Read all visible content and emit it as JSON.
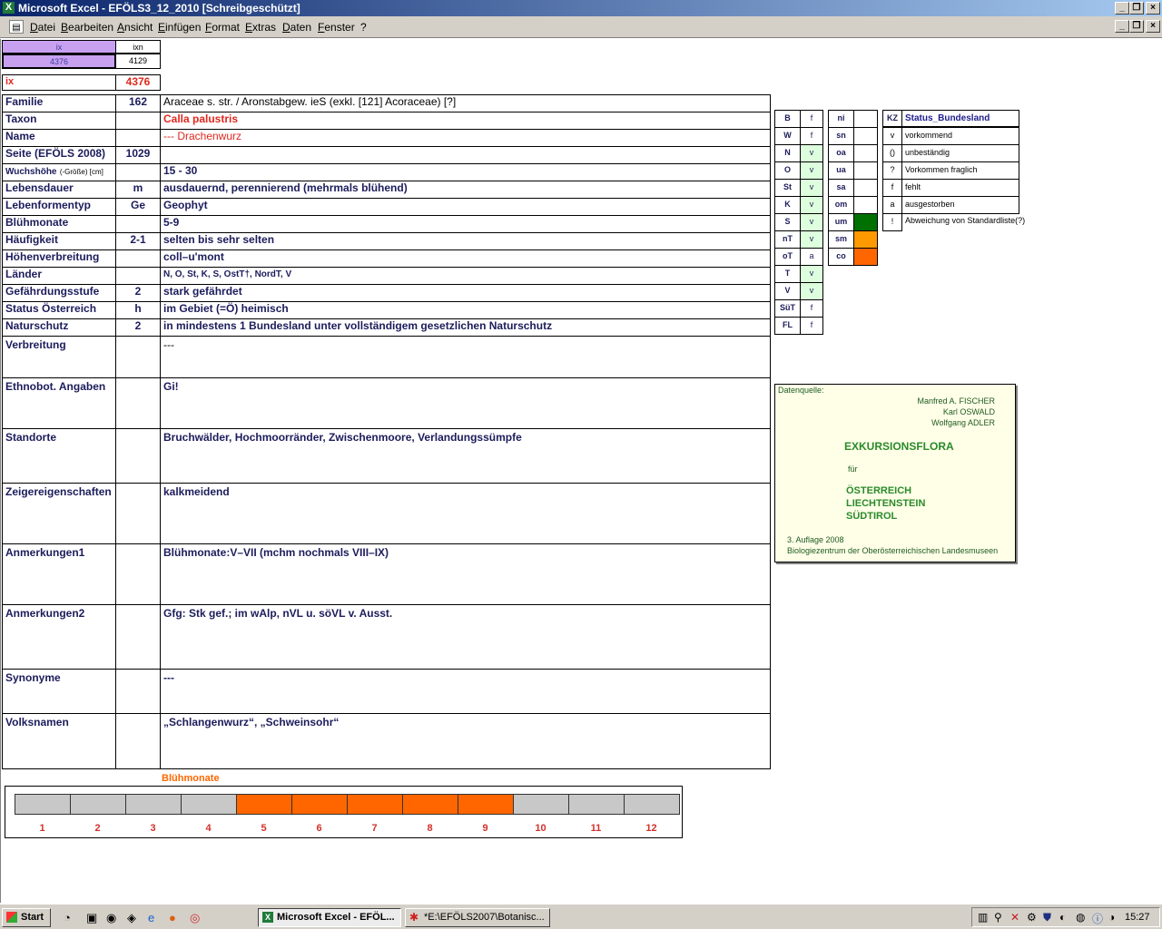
{
  "window": {
    "title": "Microsoft Excel - EFÖLS3_12_2010  [Schreibgeschützt]"
  },
  "menu": [
    "Datei",
    "Bearbeiten",
    "Ansicht",
    "Einfügen",
    "Format",
    "Extras",
    "Daten",
    "Fenster",
    "?"
  ],
  "index": {
    "ix_label": "ix",
    "ix_value": "4376",
    "ixn_label": "ixn",
    "ixn_value": "4129",
    "ix2_label": "ix",
    "ix2_value": "4376"
  },
  "rows": [
    {
      "label": "Familie",
      "code": "162",
      "value": "Araceae s. str.  /  Aronstabgew. ieS (exkl. [121] Acoraceae) [?]"
    },
    {
      "label": "Taxon",
      "code": "",
      "value": "Calla palustris"
    },
    {
      "label": "Name",
      "code": "",
      "value": "--- Drachenwurz"
    },
    {
      "label": "Seite (EFÖLS 2008)",
      "code": "1029",
      "value": ""
    },
    {
      "label": "Wuchshöhe",
      "label_suffix": "(-Größe) [cm]",
      "code": "",
      "value": " 15 - 30"
    },
    {
      "label": "Lebensdauer",
      "code": "m",
      "value": "ausdauernd, perennierend (mehrmals blühend)"
    },
    {
      "label": "Lebenformentyp",
      "code": "Ge",
      "value": "Geophyt"
    },
    {
      "label": "Blühmonate",
      "code": "",
      "value": " 5-9"
    },
    {
      "label": "Häufigkeit",
      "code": "2-1",
      "value": "selten bis sehr selten"
    },
    {
      "label": "Höhenverbreitung",
      "code": "",
      "value": "coll–u'mont"
    },
    {
      "label": "Länder",
      "code": "",
      "value": "N, O, St, K, S, OstT†, NordT, V"
    },
    {
      "label": "Gefährdungsstufe",
      "code": "2",
      "value": "stark gefährdet"
    },
    {
      "label": "Status Österreich",
      "code": "h",
      "value": "im Gebiet (=Ö) heimisch"
    },
    {
      "label": "Naturschutz",
      "code": "2",
      "value": "in mindestens 1 Bundesland unter vollständigem gesetzlichen Naturschutz"
    }
  ],
  "tall_rows": [
    {
      "label": "Verbreitung",
      "value": "---"
    },
    {
      "label": "Ethnobot. Angaben",
      "value": "Gi!"
    },
    {
      "label": "Standorte",
      "value": "Bruchwälder, Hochmoorränder, Zwischenmoore, Verlandungssümpfe"
    },
    {
      "label": "Zeigereigenschaften",
      "value": "kalkmeidend"
    },
    {
      "label": "Anmerkungen1",
      "value": "Blühmonate:V–VII (mchm nochmals VIII–IX)"
    },
    {
      "label": "Anmerkungen2",
      "value": "Gfg: Stk gef.; im wAlp, nVL u. söVL v. Ausst."
    },
    {
      "label": "Synonyme",
      "value": "---"
    },
    {
      "label": "Volksnamen",
      "value": "„Schlangenwurz“, „Schweinsohr“"
    }
  ],
  "states": [
    {
      "code": "B",
      "status": "f"
    },
    {
      "code": "W",
      "status": "f"
    },
    {
      "code": "N",
      "status": "v"
    },
    {
      "code": "O",
      "status": "v"
    },
    {
      "code": "St",
      "status": "v"
    },
    {
      "code": "K",
      "status": "v"
    },
    {
      "code": "S",
      "status": "v"
    },
    {
      "code": "nT",
      "status": "v"
    },
    {
      "code": "oT",
      "status": "a"
    },
    {
      "code": "T",
      "status": "v"
    },
    {
      "code": "V",
      "status": "v"
    },
    {
      "code": "SüT",
      "status": "f"
    },
    {
      "code": "FL",
      "status": "f"
    }
  ],
  "altitude": [
    {
      "code": "ni",
      "color": ""
    },
    {
      "code": "sn",
      "color": ""
    },
    {
      "code": "oa",
      "color": ""
    },
    {
      "code": "ua",
      "color": ""
    },
    {
      "code": "sa",
      "color": ""
    },
    {
      "code": "om",
      "color": ""
    },
    {
      "code": "um",
      "color": "#007000"
    },
    {
      "code": "sm",
      "color": "#ff9900"
    },
    {
      "code": "co",
      "color": "#ff6600"
    }
  ],
  "legend": {
    "kz_label": "KZ",
    "status_label": "Status_Bundesland",
    "items": [
      {
        "kz": "v",
        "text": "vorkommend"
      },
      {
        "kz": "()",
        "text": "unbeständig"
      },
      {
        "kz": "?",
        "text": "Vorkommen fraglich"
      },
      {
        "kz": "f",
        "text": "fehlt"
      },
      {
        "kz": "a",
        "text": "ausgestorben"
      },
      {
        "kz": "!",
        "text": "Abweichung von Standardliste(?)"
      }
    ]
  },
  "source": {
    "label": "Datenquelle:",
    "authors": [
      "Manfred A. FISCHER",
      "Karl OSWALD",
      "Wolfgang ADLER"
    ],
    "title": "EXKURSIONSFLORA",
    "fuer": "für",
    "regions": [
      "ÖSTERREICH",
      "LIECHTENSTEIN",
      "SÜDTIROL"
    ],
    "edition": "3. Auflage 2008",
    "publisher": "Biologiezentrum der Oberösterreichischen Landesmuseen"
  },
  "bloom": {
    "title": "Blühmonate",
    "months": [
      "1",
      "2",
      "3",
      "4",
      "5",
      "6",
      "7",
      "8",
      "9",
      "10",
      "11",
      "12"
    ],
    "active": [
      false,
      false,
      false,
      false,
      true,
      true,
      true,
      true,
      true,
      false,
      false,
      false
    ],
    "active_color": "#ff6600",
    "inactive_color": "#c8c8c8"
  },
  "taskbar": {
    "start": "Start",
    "tasks": [
      "Microsoft Excel - EFÖL...",
      "*E:\\EFÖLS2007\\Botanisc..."
    ],
    "time": "15:27"
  }
}
